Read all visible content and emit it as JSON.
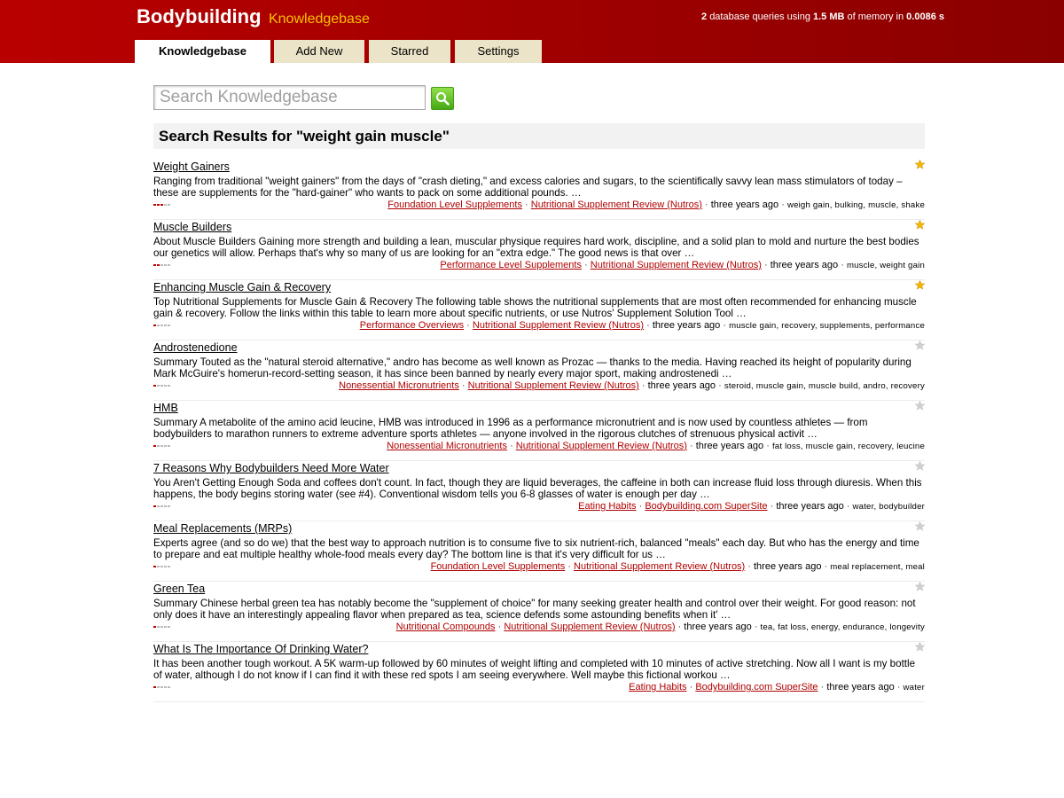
{
  "header": {
    "brand": "Bodybuilding",
    "subtitle": "Knowledgebase",
    "stats": {
      "queries": "2",
      "queries_text": "database queries using",
      "memory": "1.5 MB",
      "memory_text": "of memory in",
      "time": "0.0086 s"
    }
  },
  "tabs": [
    {
      "label": "Knowledgebase",
      "active": true
    },
    {
      "label": "Add New",
      "active": false
    },
    {
      "label": "Starred",
      "active": false
    },
    {
      "label": "Settings",
      "active": false
    }
  ],
  "search": {
    "placeholder": "Search Knowledgebase",
    "value": ""
  },
  "results_heading": "Search Results for \"weight gain muscle\"",
  "results": [
    {
      "title": "Weight Gainers",
      "description": "Ranging from traditional \"weight gainers\" from the days of \"crash dieting,\" and excess calories and sugars, to the scientifically savvy lean mass stimulators of today – these are supplements for the \"hard-gainer\" who wants to pack on some additional pounds. …",
      "rating": 3,
      "starred": true,
      "category": "Foundation Level Supplements",
      "source": "Nutritional Supplement Review (Nutros)",
      "age": "three years ago",
      "tags": "weigh gain, bulking, muscle, shake"
    },
    {
      "title": "Muscle Builders",
      "description": "About Muscle Builders Gaining more strength and building a lean, muscular physique requires hard work, discipline, and a solid plan to mold and nurture the best bodies our genetics will allow. Perhaps that's why so many of us are looking for an \"extra edge.\" The good news is that over …",
      "rating": 2,
      "starred": true,
      "category": "Performance Level Supplements",
      "source": "Nutritional Supplement Review (Nutros)",
      "age": "three years ago",
      "tags": "muscle, weight gain"
    },
    {
      "title": "Enhancing Muscle Gain & Recovery",
      "description": "Top Nutritional Supplements for Muscle Gain & Recovery The following table shows the nutritional supplements that are most often recommended for enhancing muscle gain & recovery. Follow the links within this table to learn more about specific nutrients, or use Nutros' Supplement Solution Tool …",
      "rating": 1,
      "starred": true,
      "category": "Performance Overviews",
      "source": "Nutritional Supplement Review (Nutros)",
      "age": "three years ago",
      "tags": "muscle gain, recovery, supplements, performance"
    },
    {
      "title": "Androstenedione",
      "description": "Summary Touted as the \"natural steroid alternative,\" andro has become as well known as Prozac — thanks to the media. Having reached its height of popularity during Mark McGuire's homerun-record-setting season, it has since been banned by nearly every major sport, making androstenedi …",
      "rating": 1,
      "starred": false,
      "category": "Nonessential Micronutrients",
      "source": "Nutritional Supplement Review (Nutros)",
      "age": "three years ago",
      "tags": "steroid, muscle gain, muscle build, andro, recovery"
    },
    {
      "title": "HMB",
      "description": "Summary A metabolite of the amino acid leucine, HMB was introduced in 1996 as a performance micronutrient and is now used by countless athletes — from bodybuilders to marathon runners to extreme adventure sports athletes — anyone involved in the rigorous clutches of strenuous physical activit …",
      "rating": 1,
      "starred": false,
      "category": "Nonessential Micronutrients",
      "source": "Nutritional Supplement Review (Nutros)",
      "age": "three years ago",
      "tags": "fat loss, muscle gain, recovery, leucine"
    },
    {
      "title": "7 Reasons Why Bodybuilders Need More Water",
      "description": "You Aren't Getting Enough Soda and coffees don't count. In fact, though they are liquid beverages, the caffeine in both can increase fluid loss through diuresis. When this happens, the body begins storing water (see #4). Conventional wisdom tells you 6-8 glasses of water is enough per day …",
      "rating": 1,
      "starred": false,
      "category": "Eating Habits",
      "source": "Bodybuilding.com SuperSite",
      "age": "three years ago",
      "tags": "water, bodybuilder"
    },
    {
      "title": "Meal Replacements (MRPs)",
      "description": "Experts agree (and so do we) that the best way to approach nutrition is to consume five to six nutrient-rich, balanced \"meals\" each day. But who has the energy and time to prepare and eat multiple healthy whole-food meals every day? The bottom line is that it's very difficult for us …",
      "rating": 1,
      "starred": false,
      "category": "Foundation Level Supplements",
      "source": "Nutritional Supplement Review (Nutros)",
      "age": "three years ago",
      "tags": "meal replacement, meal"
    },
    {
      "title": "Green Tea",
      "description": "Summary Chinese herbal green tea has notably become the \"supplement of choice\" for many seeking greater health and control over their weight. For good reason: not only does it have an interestingly appealing flavor when prepared as tea, science defends some astounding benefits when it' …",
      "rating": 1,
      "starred": false,
      "category": "Nutritional Compounds",
      "source": "Nutritional Supplement Review (Nutros)",
      "age": "three years ago",
      "tags": "tea, fat loss, energy, endurance, longevity"
    },
    {
      "title": "What Is The Importance Of Drinking Water?",
      "description": "It has been another tough workout. A 5K warm-up followed by 60 minutes of weight lifting and completed with 10 minutes of active stretching. Now all I want is my bottle of water, although I do not know if I can find it with these red spots I am seeing everywhere. Well maybe this fictional workou …",
      "rating": 1,
      "starred": false,
      "category": "Eating Habits",
      "source": "Bodybuilding.com SuperSite",
      "age": "three years ago",
      "tags": "water"
    }
  ],
  "colors": {
    "header_red": "#b90000",
    "accent_yellow": "#f5c000",
    "link_red": "#b00000",
    "tab_bg": "#ece4c8",
    "star_on": "#f5b800",
    "star_off": "#d0d0d0"
  }
}
